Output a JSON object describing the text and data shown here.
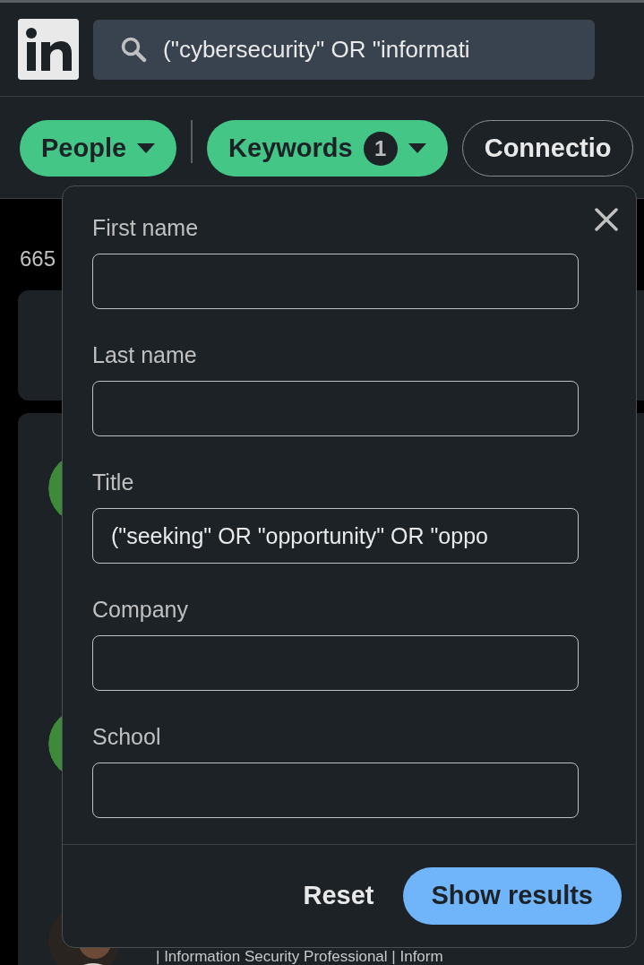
{
  "header": {
    "search": {
      "value": "(\"cybersecurity\" OR \"informati"
    }
  },
  "filters": [
    {
      "label": "People",
      "selected": true,
      "dropdown": true
    },
    {
      "label": "Keywords",
      "selected": true,
      "count": "1",
      "dropdown": true
    },
    {
      "label": "Connectio",
      "selected": false,
      "dropdown": false
    }
  ],
  "results": {
    "count": "665",
    "profiles": [
      {
        "kind": "picture"
      },
      {
        "kind": "picture"
      },
      {
        "kind": "picture",
        "snippet": "| Information Security Professional | Inform"
      }
    ]
  },
  "keywords_panel": {
    "fields": [
      {
        "label": "First name"
      },
      {
        "label": "Last name"
      },
      {
        "label": "Title",
        "value": "(\"seeking\" OR \"opportunity\" OR \"oppo"
      },
      {
        "label": "Company"
      },
      {
        "label": "School"
      }
    ],
    "reset": "Reset",
    "submit": "Show results"
  }
}
